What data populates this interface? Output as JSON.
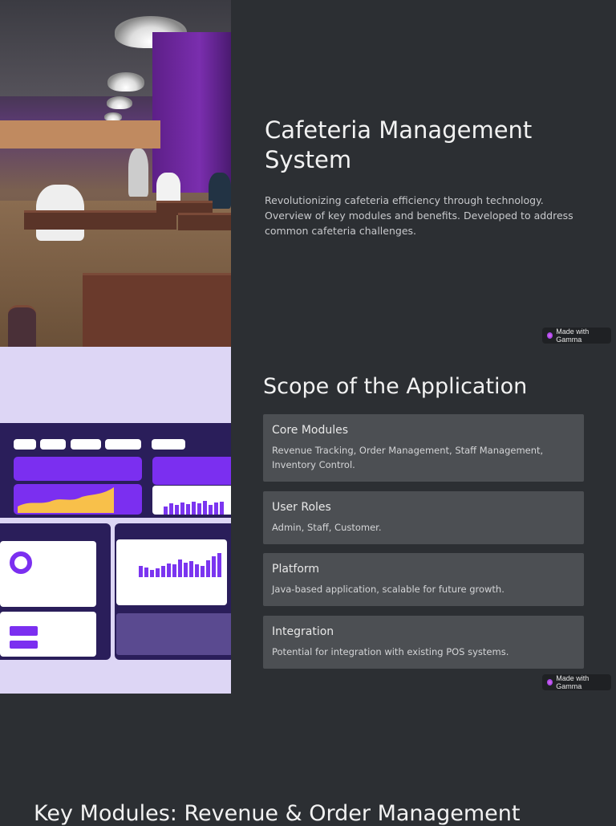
{
  "hero": {
    "title": "Cafeteria Management System",
    "description": "Revolutionizing cafeteria efficiency through technology. Overview of key modules and benefits. Developed to address common cafeteria challenges.",
    "image": "cafeteria-photo"
  },
  "badge_label": "Made with Gamma",
  "scope": {
    "title": "Scope of the Application",
    "image": "dashboard-mockup",
    "cards": [
      {
        "title": "Core Modules",
        "text": "Revenue Tracking, Order Management, Staff Management, Inventory Control."
      },
      {
        "title": "User Roles",
        "text": "Admin, Staff, Customer."
      },
      {
        "title": "Platform",
        "text": "Java-based application, scalable for future growth."
      },
      {
        "title": "Integration",
        "text": "Potential for integration with existing POS systems."
      }
    ]
  },
  "next_section": {
    "title": "Key Modules: Revenue & Order Management"
  },
  "colors": {
    "background": "#2c2f33",
    "card": "#4c4f53",
    "accent": "#7b2ff0"
  }
}
